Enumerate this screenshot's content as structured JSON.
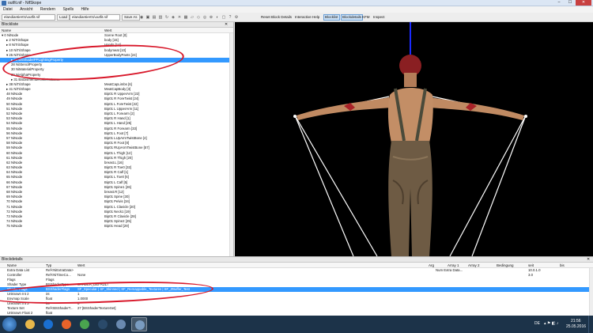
{
  "window": {
    "title": "outfit.nif - NifSkope",
    "minimize": "–",
    "maximize": "☐",
    "close": "✕"
  },
  "menu": [
    "Datei",
    "Ansicht",
    "Rendern",
    "Spells",
    "Hilfe"
  ],
  "toolbar": {
    "path1": "elandiantier01\\outfit.nif",
    "path2": "elandiantier01\\outfit.nif",
    "load": "Load",
    "save_as": "Save As",
    "reset_block": "Reset Block Details",
    "interactive_help": "Interactive Help",
    "blocklist": "Blocklist",
    "blockdetails": "Blockdetails",
    "kfm": "KFM",
    "inspect": "Inspect"
  },
  "blocklist": {
    "title": "Blockliste",
    "col_name": "Name",
    "col_value": "Wert",
    "rows": [
      {
        "name": "0 NiNode",
        "value": "Scene Root [0]",
        "indent": 0,
        "exp": "▾"
      },
      {
        "name": "2 NiTriShape",
        "value": "body [15]",
        "indent": 1,
        "exp": "▸"
      },
      {
        "name": "8 NiTriShape",
        "value": "Hands [14]",
        "indent": 1,
        "exp": "▸"
      },
      {
        "name": "10 NiTriShape",
        "value": "bodymeat [10]",
        "indent": 1,
        "exp": "▸"
      },
      {
        "name": "25 NiTriShape",
        "value": "UpperBodyPants [24]",
        "indent": 1,
        "exp": "▾"
      },
      {
        "name": "26 BSShaderPPLightingProperty",
        "value": "",
        "indent": 2,
        "exp": "▸",
        "sel": true
      },
      {
        "name": "28 NiStencilProperty",
        "value": "",
        "indent": 2,
        "exp": ""
      },
      {
        "name": "30 NiMaterialProperty",
        "value": "",
        "indent": 2,
        "exp": ""
      },
      {
        "name": "29 NiAlphaProperty",
        "value": "",
        "indent": 2,
        "exp": ""
      },
      {
        "name": "31 BSDismemberSkinInstance",
        "value": "",
        "indent": 2,
        "exp": "▸"
      },
      {
        "name": "38 NiTriShape",
        "value": "MeatCapLimbs [6]",
        "indent": 1,
        "exp": "▸"
      },
      {
        "name": "41 NiTriShape",
        "value": "MeatCapBody [3]",
        "indent": 1,
        "exp": "▸"
      },
      {
        "name": "48 NiNode",
        "value": "Bip01 R UpperArm [22]",
        "indent": 1,
        "exp": ""
      },
      {
        "name": "49 NiNode",
        "value": "Bip01 R ForeTwist [24]",
        "indent": 1,
        "exp": ""
      },
      {
        "name": "50 NiNode",
        "value": "Bip01 L ForeTwist [22]",
        "indent": 1,
        "exp": ""
      },
      {
        "name": "51 NiNode",
        "value": "Bip01 L UpperArm [11]",
        "indent": 1,
        "exp": ""
      },
      {
        "name": "52 NiNode",
        "value": "Bip01 L Forearm [2]",
        "indent": 1,
        "exp": ""
      },
      {
        "name": "53 NiNode",
        "value": "Bip01 R Hand [1]",
        "indent": 1,
        "exp": ""
      },
      {
        "name": "54 NiNode",
        "value": "Bip01 L Hand [25]",
        "indent": 1,
        "exp": ""
      },
      {
        "name": "55 NiNode",
        "value": "Bip01 R Forearm [33]",
        "indent": 1,
        "exp": ""
      },
      {
        "name": "56 NiNode",
        "value": "Bip01 L Foot [7]",
        "indent": 1,
        "exp": ""
      },
      {
        "name": "57 NiNode",
        "value": "Bip01 LUpArmTwistBone [4]",
        "indent": 1,
        "exp": ""
      },
      {
        "name": "58 NiNode",
        "value": "Bip01 R Foot [8]",
        "indent": 1,
        "exp": ""
      },
      {
        "name": "59 NiNode",
        "value": "Bip01 RUpArmTwistBone [57]",
        "indent": 1,
        "exp": ""
      },
      {
        "name": "60 NiNode",
        "value": "Bip01 L Thigh [12]",
        "indent": 1,
        "exp": ""
      },
      {
        "name": "61 NiNode",
        "value": "Bip01 R Thigh [20]",
        "indent": 1,
        "exp": ""
      },
      {
        "name": "62 NiNode",
        "value": "breast.L [16]",
        "indent": 1,
        "exp": ""
      },
      {
        "name": "63 NiNode",
        "value": "Bip01 R Toe0 [32]",
        "indent": 1,
        "exp": ""
      },
      {
        "name": "64 NiNode",
        "value": "Bip01 R Calf [1]",
        "indent": 1,
        "exp": ""
      },
      {
        "name": "65 NiNode",
        "value": "Bip01 L Toe0 [6]",
        "indent": 1,
        "exp": ""
      },
      {
        "name": "66 NiNode",
        "value": "Bip01 L Calf [5]",
        "indent": 1,
        "exp": ""
      },
      {
        "name": "67 NiNode",
        "value": "Bip01 Spine1 [26]",
        "indent": 1,
        "exp": ""
      },
      {
        "name": "68 NiNode",
        "value": "breast.R [12]",
        "indent": 1,
        "exp": ""
      },
      {
        "name": "69 NiNode",
        "value": "Bip01 Spine [30]",
        "indent": 1,
        "exp": ""
      },
      {
        "name": "70 NiNode",
        "value": "Bip01 Pelvis [34]",
        "indent": 1,
        "exp": ""
      },
      {
        "name": "71 NiNode",
        "value": "Bip01 L Clavicle [20]",
        "indent": 1,
        "exp": ""
      },
      {
        "name": "72 NiNode",
        "value": "Bip01 Neck1 [19]",
        "indent": 1,
        "exp": ""
      },
      {
        "name": "73 NiNode",
        "value": "Bip01 R Clavicle [28]",
        "indent": 1,
        "exp": ""
      },
      {
        "name": "74 NiNode",
        "value": "Bip01 Spine2 [25]",
        "indent": 1,
        "exp": ""
      },
      {
        "name": "75 NiNode",
        "value": "Bip01 Head [29]",
        "indent": 1,
        "exp": ""
      }
    ]
  },
  "blockdetails": {
    "title": "Blockdetails",
    "headers": {
      "name": "Name",
      "type": "Typ",
      "value": "Wert",
      "arg": "Arg",
      "array1": "Array 1",
      "array2": "Array 2",
      "cond": "Bedingung",
      "since": "seit",
      "until": "bis"
    },
    "rows": [
      {
        "name": "Extra Data List",
        "type": "Ref<NiExtraData>",
        "value": "",
        "arg": "",
        "array1": "Num Extra Data...",
        "since": "10.0.1.0",
        "until": ""
      },
      {
        "name": "Controller",
        "type": "Ref<NiTimeCo...",
        "value": "None",
        "arg": "",
        "array1": "",
        "since": "3.0",
        "until": ""
      },
      {
        "name": "Flags",
        "type": "Flags",
        "value": "",
        "arg": "",
        "array1": "",
        "since": "",
        "until": ""
      },
      {
        "name": "Shader Type",
        "type": "BSShaderType",
        "value": "SHADER_DEFAULT",
        "arg": "",
        "array1": "",
        "since": "",
        "until": ""
      },
      {
        "name": "Shader Flags",
        "type": "BSShaderFlags",
        "value": "SF_Specular | SF_Skinned | SF_Remappable_Textures | SF_ZBuffer_Test",
        "arg": "",
        "array1": "",
        "since": "",
        "until": "",
        "sel": true
      },
      {
        "name": "Unknown Int 2",
        "type": "int",
        "value": "1",
        "arg": "",
        "array1": "",
        "since": "",
        "until": ""
      },
      {
        "name": "Envmap Scale",
        "type": "float",
        "value": "1.0000",
        "arg": "",
        "array1": "",
        "since": "",
        "until": ""
      },
      {
        "name": "Unknown Int 3",
        "type": "int",
        "value": "0",
        "arg": "",
        "array1": "",
        "since": "",
        "until": ""
      },
      {
        "name": "Texture Set",
        "type": "Ref<BSShaderT...",
        "value": "27 [BSShaderTextureSet]",
        "arg": "",
        "array1": "",
        "since": "",
        "until": ""
      },
      {
        "name": "Unknown Float 2",
        "type": "float",
        "value": "",
        "arg": "",
        "array1": "",
        "since": "",
        "until": ""
      }
    ]
  },
  "taskbar": {
    "language": "DE",
    "time": "21:56",
    "date": "25.05.2016",
    "icons": [
      {
        "name": "explorer-icon",
        "color": "#e8b84a"
      },
      {
        "name": "media-player-icon",
        "color": "#1a6fd0"
      },
      {
        "name": "firefox-icon",
        "color": "#e8632a"
      },
      {
        "name": "chrome-icon",
        "color": "#4aa54f"
      },
      {
        "name": "steam-icon",
        "color": "#2a4a6a"
      },
      {
        "name": "app-icon",
        "color": "#6a8ab0"
      },
      {
        "name": "nifskope-icon",
        "color": "#7a9cc0",
        "active": true
      }
    ]
  },
  "colors": {
    "selection": "#3399ff",
    "annotation": "#d8182a",
    "viewport_bg": "#000000",
    "taskbar_bg": "#1c3349"
  }
}
